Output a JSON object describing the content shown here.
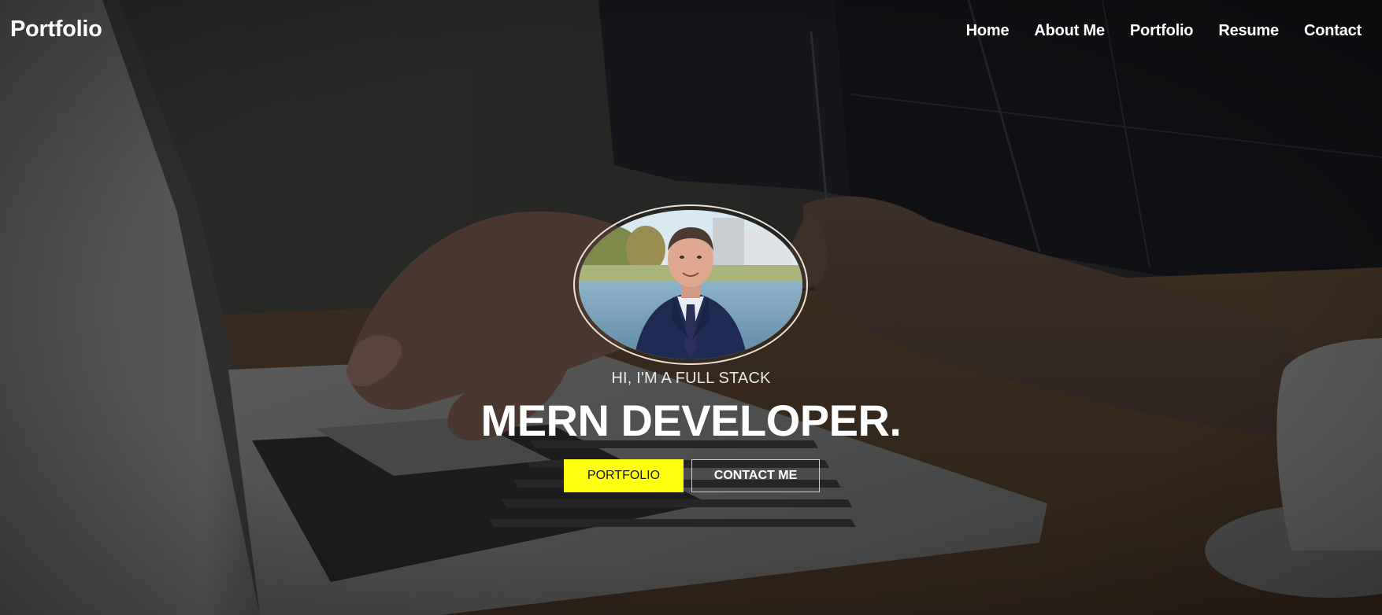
{
  "brand": {
    "label": "Portfolio"
  },
  "nav": {
    "items": [
      {
        "label": "Home"
      },
      {
        "label": "About Me"
      },
      {
        "label": "Portfolio"
      },
      {
        "label": "Resume"
      },
      {
        "label": "Contact"
      }
    ]
  },
  "hero": {
    "tagline": "HI, I'M A FULL STACK",
    "headline": "MERN DEVELOPER.",
    "primary_button": "PORTFOLIO",
    "secondary_button": "CONTACT ME",
    "background_description": "hands typing on laptop, dark overlay",
    "avatar_description": "man in navy suit"
  },
  "colors": {
    "accent_yellow": "#ffff11",
    "text_white": "#ffffff",
    "overlay_dark": "#1b1b1b"
  }
}
